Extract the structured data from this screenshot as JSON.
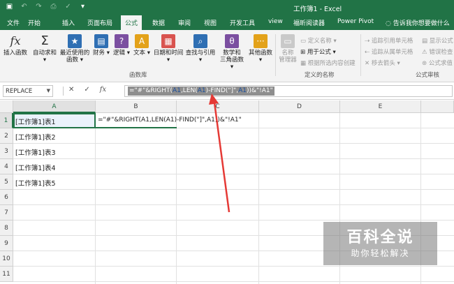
{
  "window": {
    "title": "工作簿1 - Excel"
  },
  "tabs": [
    "文件",
    "开始",
    "插入",
    "页面布局",
    "公式",
    "数据",
    "审阅",
    "视图",
    "开发工具",
    "view",
    "福昕阅读器",
    "Power Pivot"
  ],
  "active_tab": "公式",
  "tell_me": "告诉我你想要做什么",
  "ribbon": {
    "function_library": {
      "insert_function": "插入函数",
      "autosum": "自动求和",
      "recent_line1": "最近使用的",
      "recent_line2": "函数",
      "financial": "财务",
      "logical": "逻辑",
      "text": "文本",
      "datetime": "日期和时间",
      "lookup": "查找与引用",
      "math_line1": "数学和",
      "math_line2": "三角函数",
      "more": "其他函数",
      "group_label": "函数库"
    },
    "defined_names": {
      "name_manager_line1": "名称",
      "name_manager_line2": "管理器",
      "define_name": "定义名称",
      "use_in_formula": "用于公式",
      "create_from_selection": "根据所选内容创建",
      "group_label": "定义的名称"
    },
    "formula_auditing": {
      "trace_precedents": "追踪引用单元格",
      "trace_dependents": "追踪从属单元格",
      "remove_arrows": "移去箭头",
      "show_formulas": "显示公式",
      "error_checking": "错误检查",
      "evaluate_formula": "公式求值",
      "group_label": "公式审核"
    }
  },
  "formula_bar": {
    "name_box": "REPLACE",
    "formula": {
      "p1": "=\"#\"&RIGHT(",
      "r1": "A1",
      "p2": ",LEN(",
      "r2": "A1",
      "p3": ")-FIND(\"]\",",
      "r3": "A1",
      "p4": "))&\"!A1\""
    }
  },
  "sheet": {
    "columns": [
      "A",
      "B",
      "C",
      "D",
      "E"
    ],
    "rows": [
      "1",
      "2",
      "3",
      "4",
      "5",
      "6",
      "7",
      "8",
      "9",
      "10",
      "11"
    ],
    "cells": {
      "a1": "[工作簿1]表1",
      "a2": "[工作簿1]表2",
      "a3": "[工作簿1]表3",
      "a4": "[工作簿1]表4",
      "a5": "[工作簿1]表5",
      "b1": "=\"#\"&RIGHT(A1,LEN(A1)-FIND(\"]\",A1))&\"!A1\""
    },
    "active_cell": "A1"
  },
  "annotation": {
    "arrow_color": "#e53935"
  },
  "watermark": {
    "title": "百科全说",
    "subtitle": "助你轻松解决"
  }
}
